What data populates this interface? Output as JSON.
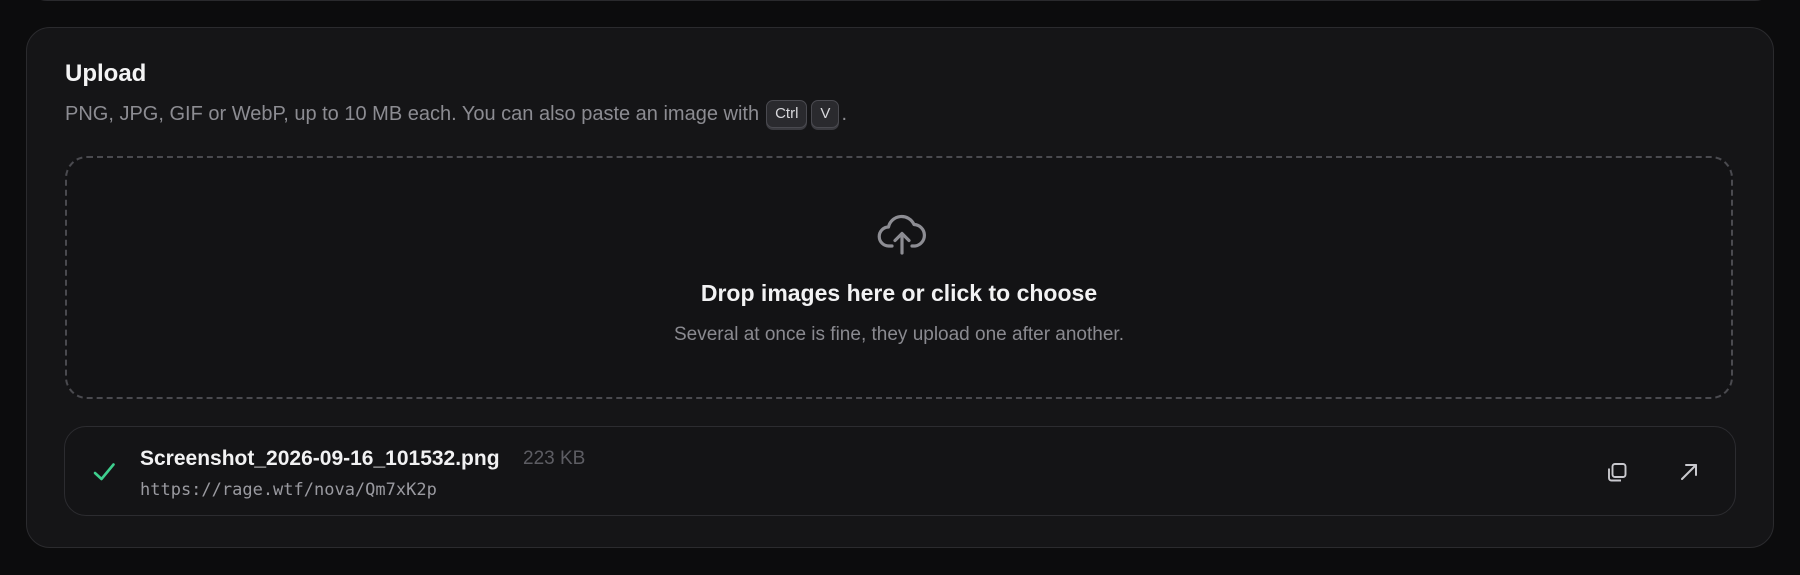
{
  "upload": {
    "title": "Upload",
    "subtitle_prefix": "PNG, JPG, GIF or WebP, up to 10 MB each. You can also paste an image with",
    "subtitle_suffix": ".",
    "shortcut_keys": [
      "Ctrl",
      "V"
    ]
  },
  "dropzone": {
    "icon": "cloud-upload-icon",
    "title": "Drop images here or click to choose",
    "subtitle": "Several at once is fine, they upload one after another."
  },
  "files": [
    {
      "status_icon": "check-icon",
      "status_color": "#3ecf8e",
      "name": "Screenshot_2026-09-16_101532.png",
      "size": "223 KB",
      "url": "https://rage.wtf/nova/Qm7xK2p",
      "actions": [
        "copy-icon",
        "open-external-icon"
      ]
    }
  ]
}
